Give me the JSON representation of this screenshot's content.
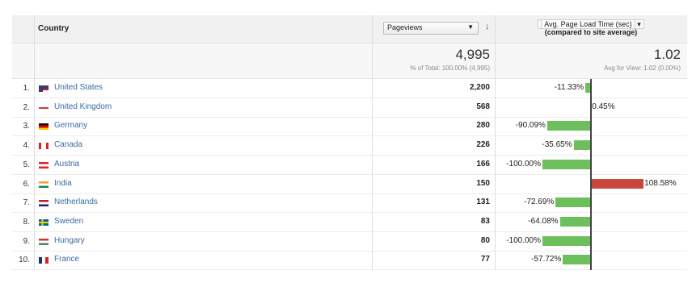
{
  "header": {
    "country": "Country",
    "pageviews_select": "Pageviews",
    "avg_title": "Avg. Page Load Time (sec)",
    "avg_subtitle": "(compared to site average)"
  },
  "summary": {
    "pageviews_total": "4,995",
    "pageviews_sub": "% of Total: 100.00% (4,995)",
    "avg_total": "1.02",
    "avg_sub": "Avg for View: 1.02 (0.00%)"
  },
  "colors": {
    "positive": "#c9463d",
    "negative": "#6cbf5a",
    "link": "#3b6aa3"
  },
  "rows": [
    {
      "idx": "1.",
      "country": "United States",
      "flag": "us-flag-icon",
      "pageviews": "2,200",
      "pct": "-11.33%",
      "value": -11.33
    },
    {
      "idx": "2.",
      "country": "United Kingdom",
      "flag": "uk-flag-icon",
      "pageviews": "568",
      "pct": "0.45%",
      "value": 0.45
    },
    {
      "idx": "3.",
      "country": "Germany",
      "flag": "germany-flag-icon",
      "pageviews": "280",
      "pct": "-90.09%",
      "value": -90.09
    },
    {
      "idx": "4.",
      "country": "Canada",
      "flag": "canada-flag-icon",
      "pageviews": "226",
      "pct": "-35.65%",
      "value": -35.65
    },
    {
      "idx": "5.",
      "country": "Austria",
      "flag": "austria-flag-icon",
      "pageviews": "166",
      "pct": "-100.00%",
      "value": -100.0
    },
    {
      "idx": "6.",
      "country": "India",
      "flag": "india-flag-icon",
      "pageviews": "150",
      "pct": "108.58%",
      "value": 108.58
    },
    {
      "idx": "7.",
      "country": "Netherlands",
      "flag": "netherlands-flag-icon",
      "pageviews": "131",
      "pct": "-72.69%",
      "value": -72.69
    },
    {
      "idx": "8.",
      "country": "Sweden",
      "flag": "sweden-flag-icon",
      "pageviews": "83",
      "pct": "-64.08%",
      "value": -64.08
    },
    {
      "idx": "9.",
      "country": "Hungary",
      "flag": "hungary-flag-icon",
      "pageviews": "80",
      "pct": "-100.00%",
      "value": -100.0
    },
    {
      "idx": "10.",
      "country": "France",
      "flag": "france-flag-icon",
      "pageviews": "77",
      "pct": "-57.72%",
      "value": -57.72
    }
  ]
}
